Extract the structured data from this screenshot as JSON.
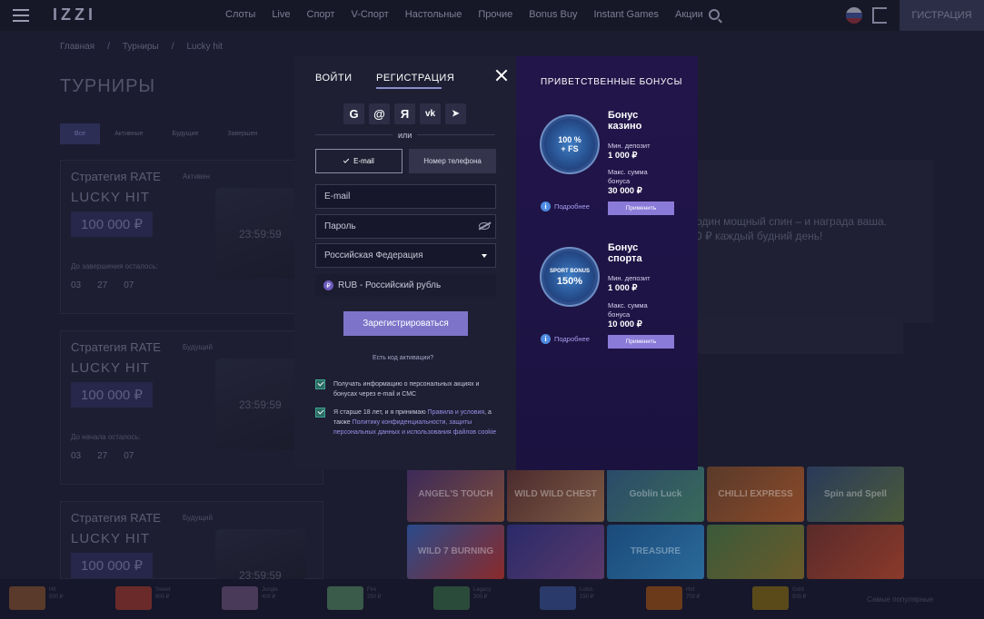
{
  "header": {
    "logo": "IZZI",
    "nav": [
      "Слоты",
      "Live",
      "Спорт",
      "V-Спорт",
      "Настольные",
      "Прочие",
      "Bonus Buy",
      "Instant Games",
      "Акции"
    ],
    "register_button": "ГИСТРАЦИЯ"
  },
  "page": {
    "breadcrumbs": [
      "Главная",
      "/",
      "Турниры",
      "/",
      "Lucky hit"
    ],
    "title": "ТУРНИРЫ",
    "filters": [
      "Все",
      "Активные",
      "Будущие",
      "Завершен"
    ],
    "tournaments": [
      {
        "strategy": "Стратегия RATE",
        "status": "Активен",
        "name": "LUCKY HIT",
        "prize": "100 000 ₽",
        "until": "До завершения осталось:",
        "timer": [
          "03",
          "27",
          "07"
        ],
        "clock": "23:59:59"
      },
      {
        "strategy": "Стратегия RATE",
        "status": "Будущий",
        "name": "LUCKY HIT",
        "prize": "100 000 ₽",
        "until": "До начала осталось:",
        "timer": [
          "03",
          "27",
          "07"
        ],
        "clock": "23:59:59"
      },
      {
        "strategy": "Стратегия RATE",
        "status": "Будущий",
        "name": "LUCKY HIT",
        "prize": "100 000 ₽",
        "until": "",
        "timer": [],
        "clock": "23:59:59"
      }
    ],
    "promo_text_line1": "один мощный спин – и награда ваша.",
    "promo_text_line2": "0 ₽ каждый будний день!",
    "games": [
      "ANGEL'S TOUCH",
      "WILD WILD CHEST",
      "Goblin Luck",
      "CHILLI EXPRESS",
      "Spin and Spell",
      "WILD 7 BURNING",
      "",
      "TREASURE",
      "",
      ""
    ]
  },
  "modal": {
    "tab_login": "ВОЙТИ",
    "tab_register": "РЕГИСТРАЦИЯ",
    "social_icons": [
      "google-icon",
      "mail-icon",
      "yandex-icon",
      "vk-icon",
      "telegram-icon"
    ],
    "social_glyphs": [
      "G",
      "@",
      "Я",
      "vk",
      "➤"
    ],
    "or_text": "или",
    "seg_email": "E-mail",
    "seg_phone": "Номер телефона",
    "email_placeholder": "E-mail",
    "password_placeholder": "Пароль",
    "country": "Российская Федерация",
    "currency": "RUB - Российский рубль",
    "currency_icon": "₽",
    "submit": "Зарегистрироваться",
    "promo_code_link": "Есть код активации?",
    "consent1": "Получать информацию о персональных акциях и бонусах через e-mail и СМС",
    "consent2_a": "Я старше 18 лет, и я принимаю ",
    "consent2_link1": "Правила и условия",
    "consent2_b": ", а также ",
    "consent2_link2": "Политику конфиденциальности, защиты персональных данных и использования файлов cookie"
  },
  "bonuses": {
    "title": "ПРИВЕТСТВЕННЫЕ БОНУСЫ",
    "items": [
      {
        "badge_line1": "100 %",
        "badge_line2": "+ FS",
        "name_line1": "Бонус",
        "name_line2": "казино",
        "min_label": "Мин. депозит",
        "min_value": "1 000 ₽",
        "max_label_line1": "Макс. сумма",
        "max_label_line2": "бонуса",
        "max_value": "30 000 ₽",
        "apply": "Применить",
        "more": "Подробнее"
      },
      {
        "badge_line1": "SPORT BONUS",
        "badge_line2": "150%",
        "name_line1": "Бонус",
        "name_line2": "спорта",
        "min_label": "Мин. депозит",
        "min_value": "1 000 ₽",
        "max_label_line1": "Макс. сумма",
        "max_label_line2": "бонуса",
        "max_value": "10 000 ₽",
        "apply": "Применить",
        "more": "Подробнее"
      }
    ]
  },
  "bottom": {
    "winners_label": "Самые популярные",
    "winners": [
      {
        "game": "Hit",
        "amount": "500 ₽"
      },
      {
        "game": "Sweet",
        "amount": "800 ₽"
      },
      {
        "game": "Jungle",
        "amount": "400 ₽"
      },
      {
        "game": "Fire",
        "amount": "250 ₽"
      },
      {
        "game": "Legacy",
        "amount": "300 ₽"
      },
      {
        "game": "Lotus",
        "amount": "150 ₽"
      },
      {
        "game": "Hot",
        "amount": "700 ₽"
      },
      {
        "game": "Gold",
        "amount": "500 ₽"
      }
    ]
  }
}
